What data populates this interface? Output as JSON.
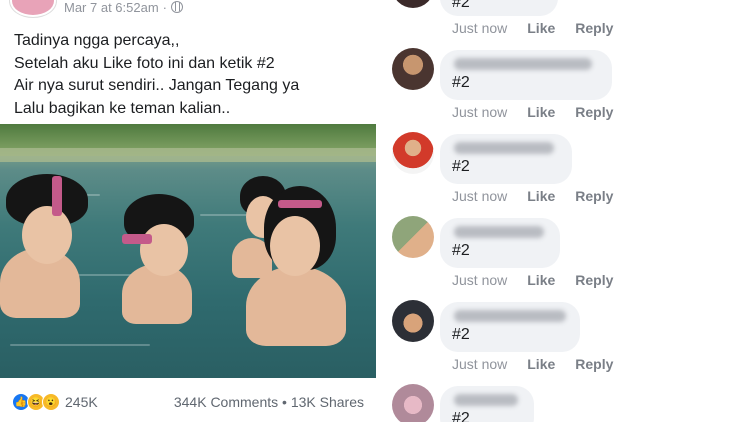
{
  "post": {
    "timestamp": "Mar 7 at 6:52am",
    "privacy_icon": "globe-icon",
    "text_lines": [
      "Tadinya ngga percaya,,",
      "Setelah aku Like foto ini dan ketik #2",
      "Air nya surut sendiri.. Jangan Tegang ya",
      "Lalu bagikan ke teman kalian.."
    ],
    "photo_icon": "river-bathing-photo",
    "reaction_count": "245K",
    "comments_count": "344K Comments",
    "separator": "•",
    "shares_count": "13K Shares"
  },
  "comments": [
    {
      "text": "#2",
      "time": "Just now",
      "like": "Like",
      "reply": "Reply",
      "avatar_color": "#3b2a2a"
    },
    {
      "text": "#2",
      "time": "Just now",
      "like": "Like",
      "reply": "Reply",
      "avatar_color": "#4a3530"
    },
    {
      "text": "#2",
      "time": "Just now",
      "like": "Like",
      "reply": "Reply",
      "avatar_color": "#d23a2a"
    },
    {
      "text": "#2",
      "time": "Just now",
      "like": "Like",
      "reply": "Reply",
      "avatar_color": "#8fa57a"
    },
    {
      "text": "#2",
      "time": "Just now",
      "like": "Like",
      "reply": "Reply",
      "avatar_color": "#2c2f36"
    },
    {
      "text": "#2",
      "time": "",
      "like": "",
      "reply": "",
      "avatar_color": "#b08a9a"
    }
  ],
  "colors": {
    "bubble": "#f0f2f5",
    "meta_text": "#90949c",
    "like_blue": "#1877f2"
  }
}
